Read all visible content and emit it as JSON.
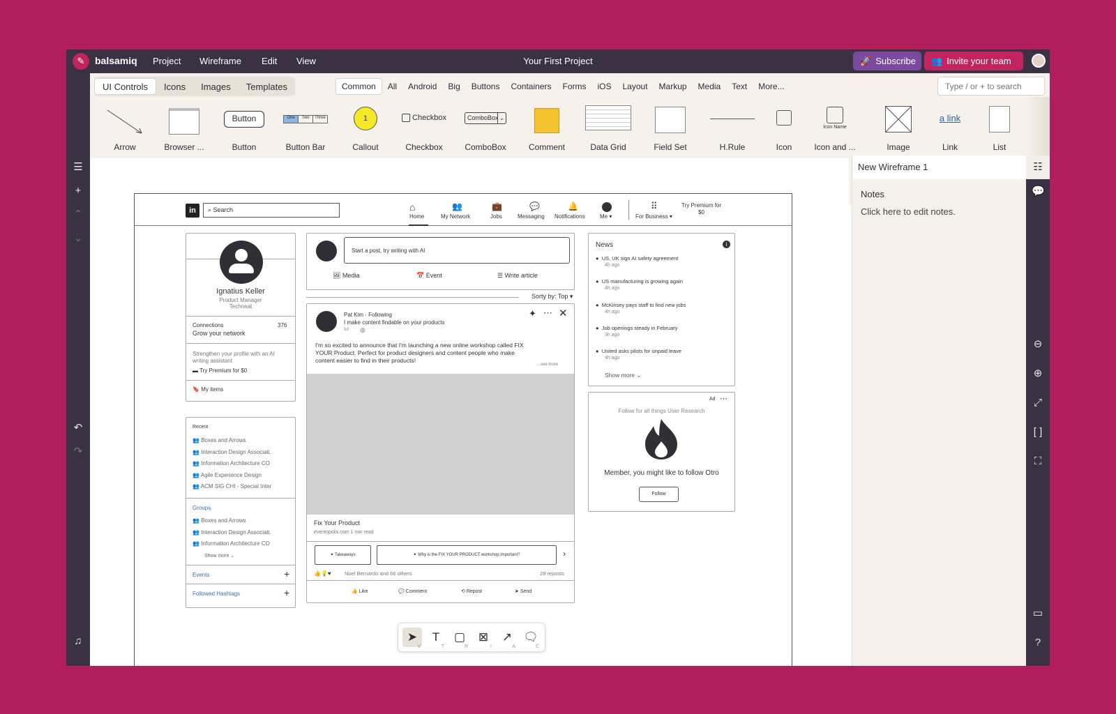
{
  "app": {
    "brand": "balsamiq",
    "menu": [
      "Project",
      "Wireframe",
      "Edit",
      "View"
    ],
    "title": "Your First Project",
    "subscribe_label": "Subscribe",
    "invite_label": "Invite your team"
  },
  "library": {
    "tabs": [
      "UI Controls",
      "Icons",
      "Images",
      "Templates"
    ],
    "categories": [
      "Common",
      "All",
      "Android",
      "Big",
      "Buttons",
      "Containers",
      "Forms",
      "iOS",
      "Layout",
      "Markup",
      "Media",
      "Text",
      "More..."
    ],
    "search_placeholder": "Type / or + to search",
    "controls": [
      "Arrow",
      "Browser ...",
      "Button",
      "Button Bar",
      "Callout",
      "Checkbox",
      "ComboBox",
      "Comment",
      "Data Grid",
      "Field Set",
      "H.Rule",
      "Icon",
      "Icon and ...",
      "Image",
      "Link",
      "List"
    ],
    "previews": {
      "button": "Button",
      "buttonbar": [
        "One",
        "Two",
        "Three"
      ],
      "callout": "1",
      "checkbox": "Checkbox",
      "combobox": "ComboBox",
      "icon_name": "Icon Name",
      "link": "a link"
    }
  },
  "panel": {
    "title": "New Wireframe 1",
    "notes_label": "Notes",
    "notes_placeholder": "Click here to edit notes."
  },
  "wireframe": {
    "search": "Search",
    "nav": [
      "Home",
      "My Network",
      "Jobs",
      "Messaging",
      "Notifications",
      "Me",
      "For Business"
    ],
    "premium_top": [
      "Try Premium for",
      "$0"
    ],
    "profile": {
      "name": "Ignatius Keller",
      "role": "Product Manager",
      "company": "Techneat",
      "connections_label": "Connections",
      "connections_count": "376",
      "grow": "Grow your network",
      "strengthen": [
        "Strengthen your profile with an AI",
        "writing assistant"
      ],
      "premium": "Try Premium for $0",
      "items": "My items"
    },
    "recent": {
      "heading": "Recent",
      "items": [
        "Boxes and Arrows",
        "Interaction Design Associati.",
        "Information Architecture CO",
        "Agile Experience Design",
        "ACM SIG CHI - Special Inter"
      ],
      "groups_heading": "Groups",
      "groups": [
        "Boxes and Arrows",
        "Interaction Design Associati.",
        "Information Architecture CO"
      ],
      "show_more": "Show more",
      "events": "Events",
      "hashtags": "Followed Hashtags"
    },
    "composer": {
      "placeholder": "Start a post, try writing with AI",
      "media": "Media",
      "event": "Event",
      "article": "Write article",
      "sort": "Sorty by: Top"
    },
    "post": {
      "author": "Pat Kim",
      "following": "Following",
      "headline": "I make content findable on your products",
      "age": "5d",
      "body": [
        "I'm so excited to announce that I'm launching a new online workshop called FIX",
        "YOUR Product. Perfect for product designers and content people who make",
        "content easier to find in their products!"
      ],
      "see_more": "...see more",
      "link_title": "Fix Your Product",
      "link_meta": "eventopolis.com 1 min read",
      "chip1": "Takeaways",
      "chip2": "Why is the FIX YOUR PRODUCT workshop important?",
      "reactions": "Noel Bernardo and 66 others",
      "reposts": "28 reposts",
      "actions": [
        "Like",
        "Comment",
        "Repost",
        "Send"
      ]
    },
    "news": {
      "heading": "News",
      "items": [
        {
          "title": "US, UK sign AI safety agreement",
          "age": "4h ago"
        },
        {
          "title": "US manufacturing is growing again",
          "age": "4h ago"
        },
        {
          "title": "McKinsey pays staff to find new jobs",
          "age": "4h ago"
        },
        {
          "title": "Job openings steady in February",
          "age": "3h ago"
        },
        {
          "title": "United asks pilots for unpaid leave",
          "age": "4h ago"
        }
      ],
      "show_more": "Show more"
    },
    "ad": {
      "label": "Ad",
      "tagline": "Follow for all things User Research",
      "message": "Member, you might like to follow Otro",
      "follow": "Follow"
    }
  },
  "toolbar": {
    "keys": [
      "V",
      "T",
      "R",
      "I",
      "A",
      "C"
    ]
  }
}
